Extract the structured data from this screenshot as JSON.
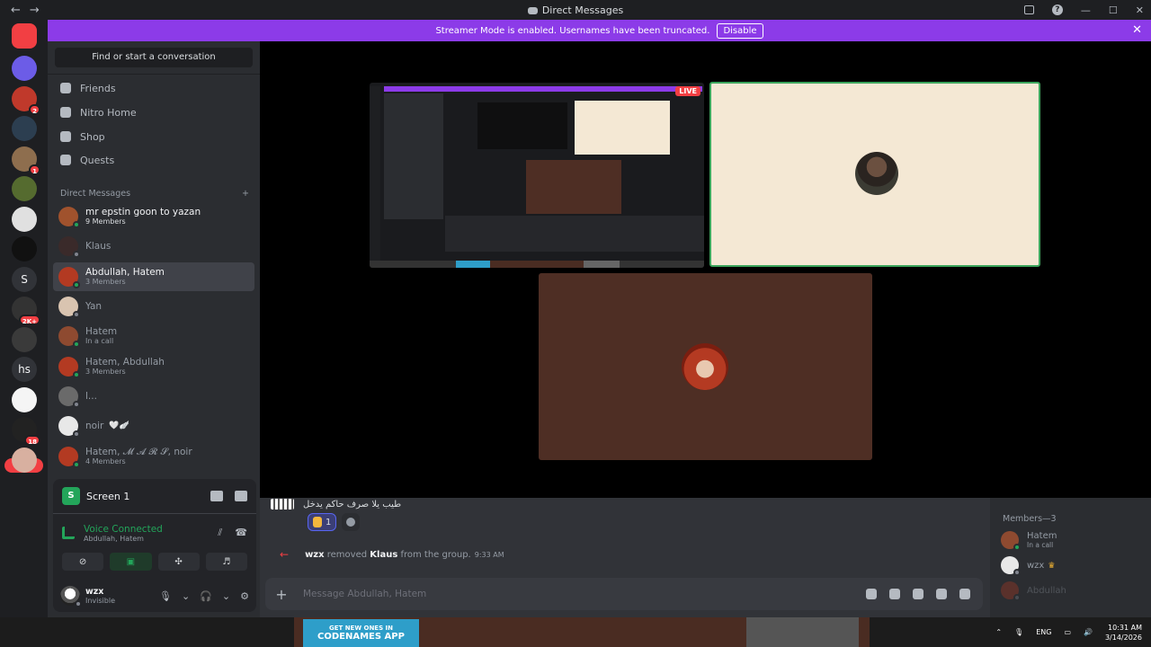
{
  "window": {
    "title": "Direct Messages",
    "back_icon": "←",
    "forward_icon": "→",
    "minimize_icon": "—",
    "maximize_icon": "☐",
    "close_icon": "✕"
  },
  "banner": {
    "text": "Streamer Mode is enabled. Usernames have been truncated.",
    "button": "Disable",
    "close_icon": "✕"
  },
  "rail": {
    "home_icon": "discord-logo",
    "servers": [
      {
        "color": "#6c5ce7"
      },
      {
        "color": "#c0392b",
        "badge": "2"
      },
      {
        "color": "#2c3e50"
      },
      {
        "color": "#8e6e4e",
        "badge": "1"
      },
      {
        "color": "#556b2f"
      },
      {
        "color": "#e0e0e0"
      },
      {
        "color": "#111111"
      },
      {
        "label": "S",
        "color": "#313338"
      },
      {
        "color": "#333333",
        "badge": "2K+"
      },
      {
        "color": "#3a3a3a"
      },
      {
        "label": "hs",
        "color": "#313338"
      },
      {
        "color": "#f5f5f5"
      },
      {
        "color": "#222222",
        "badge": "18"
      },
      {
        "color": "#d8b0a0"
      }
    ],
    "new_label": "NEW"
  },
  "sidebar": {
    "search": "Find or start a conversation",
    "nav": [
      {
        "label": "Friends",
        "icon": "friends-icon"
      },
      {
        "label": "Nitro Home",
        "icon": "nitro-icon"
      },
      {
        "label": "Shop",
        "icon": "shop-icon"
      },
      {
        "label": "Quests",
        "icon": "quests-icon"
      }
    ],
    "dm_header": "Direct Messages",
    "dm_add": "+",
    "dms": [
      {
        "name": "mr epstin goon to yazan",
        "sub": "9 Members",
        "color": "#a0522d",
        "status": "#23a55a",
        "bold": true
      },
      {
        "name": "Klaus",
        "sub": "",
        "color": "#3a2a2a",
        "status": "#80848e"
      },
      {
        "name": "Abdullah, Hatem",
        "sub": "3 Members",
        "color": "#b33a22",
        "status": "#23a55a",
        "sel": true
      },
      {
        "name": "Yan",
        "sub": "",
        "color": "#d9c4b0",
        "status": "#80848e"
      },
      {
        "name": "Hatem",
        "sub": "In a call",
        "color": "#8e4a30",
        "status": "#23a55a"
      },
      {
        "name": "Hatem, Abdullah",
        "sub": "3 Members",
        "color": "#b33a22",
        "status": "#23a55a"
      },
      {
        "name": "l...",
        "sub": "",
        "color": "#6a6a6a",
        "status": "#80848e"
      },
      {
        "name": "noir",
        "sub": "",
        "color": "#e8e8e8",
        "status": "#80848e",
        "tag": "🤍🪽"
      },
      {
        "name": "Hatem, 𝓜 𝓐 𝓡 𝓢, noir",
        "sub": "4 Members",
        "color": "#b33a22",
        "status": "#23a55a"
      }
    ]
  },
  "voice": {
    "screen_label": "Screen 1",
    "screen_icon": "S",
    "status": "Voice Connected",
    "channel": "Abdullah, Hatem"
  },
  "user": {
    "name": "wzx",
    "status": "Invisible"
  },
  "chat": {
    "prev_message": "طيب يلا صرف حاكم يدخل",
    "reaction_count": "1",
    "system_actor": "wzx",
    "system_verb": "removed",
    "system_target": "Klaus",
    "system_rest": "from the group.",
    "system_time": "9:33 AM",
    "composer_placeholder": "Message Abdullah, Hatem",
    "plus_icon": "+"
  },
  "stage": {
    "live_label": "LIVE"
  },
  "members": {
    "header": "Members—3",
    "list": [
      {
        "name": "Hatem",
        "sub": "In a call",
        "color": "#8e4a30",
        "status": "#23a55a"
      },
      {
        "name": "wzx",
        "sub": "",
        "color": "#e8e8e8",
        "status": "#80848e",
        "crown": "♛"
      },
      {
        "name": "Abdullah",
        "sub": "",
        "color": "#b33a22",
        "status": "#80848e",
        "dim": true
      }
    ]
  },
  "taskbar": {
    "ad_line1": "GET NEW ONES IN",
    "ad_line2": "CODENAMES APP",
    "tray_lang": "ENG",
    "time": "10:31 AM",
    "date": "3/14/2026"
  }
}
